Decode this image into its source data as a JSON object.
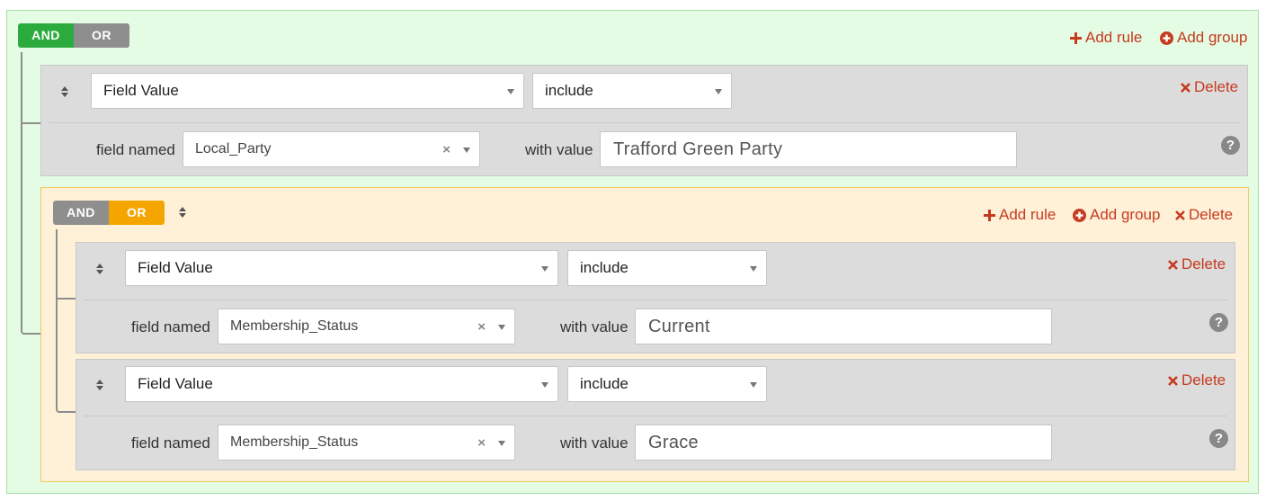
{
  "root_group": {
    "condition_and": "AND",
    "condition_or": "OR",
    "add_rule": "Add rule",
    "add_group": "Add group"
  },
  "rule1": {
    "field": "Field Value",
    "operator": "include",
    "delete": "Delete",
    "field_named_label": "field named",
    "field_named_value": "Local_Party",
    "with_value_label": "with value",
    "value": "Trafford Green Party"
  },
  "sub_group": {
    "condition_and": "AND",
    "condition_or": "OR",
    "add_rule": "Add rule",
    "add_group": "Add group",
    "delete": "Delete"
  },
  "rule2": {
    "field": "Field Value",
    "operator": "include",
    "delete": "Delete",
    "field_named_label": "field named",
    "field_named_value": "Membership_Status",
    "with_value_label": "with value",
    "value": "Current"
  },
  "rule3": {
    "field": "Field Value",
    "operator": "include",
    "delete": "Delete",
    "field_named_label": "field named",
    "field_named_value": "Membership_Status",
    "with_value_label": "with value",
    "value": "Grace"
  },
  "colors": {
    "and_active": "#2bab3d",
    "or_active": "#f5a500",
    "inactive": "#8e8e8e",
    "action": "#c63a1f"
  },
  "icons": {
    "add_rule": "plus-icon",
    "add_group": "plus-circle-icon",
    "delete": "times-icon",
    "drag": "sort-icon",
    "help": "question-circle-icon"
  }
}
